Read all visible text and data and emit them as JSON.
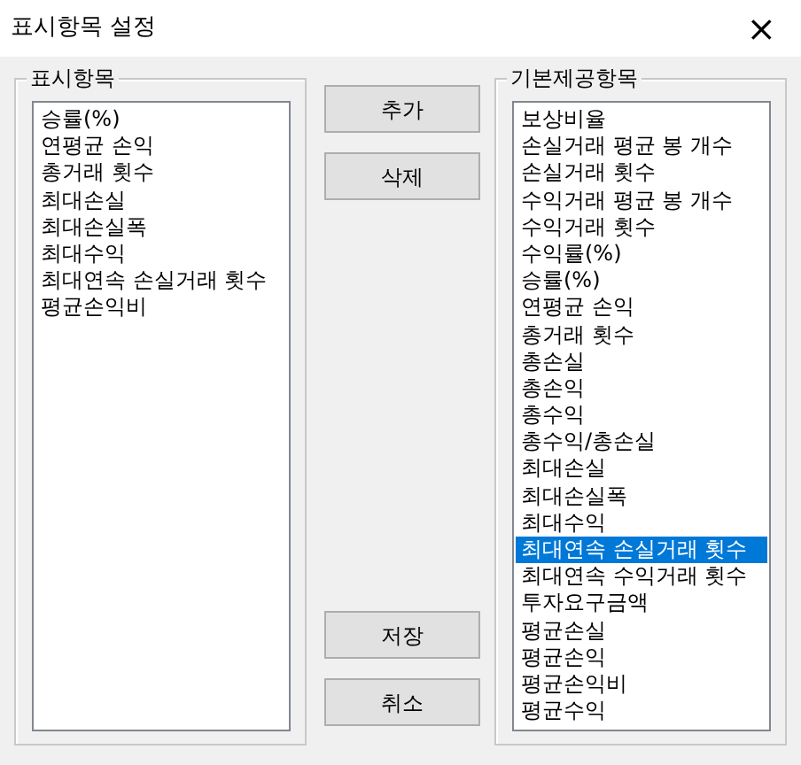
{
  "window": {
    "title": "표시항목 설정",
    "close": "×"
  },
  "display_group": {
    "label": "표시항목",
    "items": [
      {
        "text": "승률(%)",
        "selected": false
      },
      {
        "text": "연평균 손익",
        "selected": false
      },
      {
        "text": "총거래 횟수",
        "selected": false
      },
      {
        "text": "최대손실",
        "selected": false
      },
      {
        "text": "최대손실폭",
        "selected": false
      },
      {
        "text": "최대수익",
        "selected": false
      },
      {
        "text": "최대연속 손실거래 횟수",
        "selected": false
      },
      {
        "text": "평균손익비",
        "selected": false
      }
    ]
  },
  "buttons_top": [
    "추가",
    "삭제"
  ],
  "buttons_bottom": [
    "저장",
    "취소"
  ],
  "default_group": {
    "label": "기본제공항목",
    "items": [
      {
        "text": "보상비율",
        "selected": false
      },
      {
        "text": "손실거래 평균 봉 개수",
        "selected": false
      },
      {
        "text": "손실거래 횟수",
        "selected": false
      },
      {
        "text": "수익거래 평균 봉 개수",
        "selected": false
      },
      {
        "text": "수익거래 횟수",
        "selected": false
      },
      {
        "text": "수익률(%)",
        "selected": false
      },
      {
        "text": "승률(%)",
        "selected": false
      },
      {
        "text": "연평균 손익",
        "selected": false
      },
      {
        "text": "총거래 횟수",
        "selected": false
      },
      {
        "text": "총손실",
        "selected": false
      },
      {
        "text": "총손익",
        "selected": false
      },
      {
        "text": "총수익",
        "selected": false
      },
      {
        "text": "총수익/총손실",
        "selected": false
      },
      {
        "text": "최대손실",
        "selected": false
      },
      {
        "text": "최대손실폭",
        "selected": false
      },
      {
        "text": "최대수익",
        "selected": false
      },
      {
        "text": "최대연속 손실거래 횟수",
        "selected": true
      },
      {
        "text": "최대연속 수익거래 횟수",
        "selected": false
      },
      {
        "text": "투자요구금액",
        "selected": false
      },
      {
        "text": "평균손실",
        "selected": false
      },
      {
        "text": "평균손익",
        "selected": false
      },
      {
        "text": "평균손익비",
        "selected": false
      },
      {
        "text": "평균수익",
        "selected": false
      }
    ]
  }
}
